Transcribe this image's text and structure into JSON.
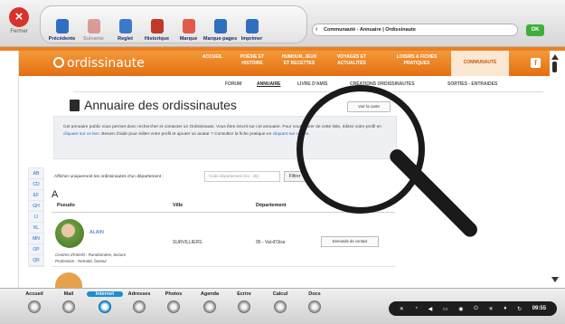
{
  "topbar": {
    "close_label": "Fermer",
    "close_glyph": "×",
    "toolbar": [
      {
        "label": "Précédente",
        "icon": "back-page-icon",
        "color": "#2f6fc2",
        "disabled": false
      },
      {
        "label": "Suivante",
        "icon": "forward-page-icon",
        "color": "#c0392b",
        "disabled": true
      },
      {
        "label": "Reglet",
        "icon": "ruler-icon",
        "color": "#3a7ac9",
        "disabled": false
      },
      {
        "label": "Historique",
        "icon": "history-icon",
        "color": "#c0392b",
        "disabled": false
      },
      {
        "label": "Marque",
        "icon": "bookmark-icon",
        "color": "#e45a4a",
        "disabled": false
      },
      {
        "label": "Marque-pages",
        "icon": "bookmarks-icon",
        "color": "#2f6fc2",
        "disabled": false
      },
      {
        "label": "Imprimer",
        "icon": "printer-icon",
        "color": "#2f6fc2",
        "disabled": false
      }
    ],
    "address": "Communauté - Annuaire | Ordissinaute",
    "ok_label": "OK"
  },
  "site": {
    "logo": "ordissinaute",
    "nav": [
      {
        "label": "ACCUEIL",
        "active": false
      },
      {
        "label": "POÉSIE ET HISTOIRE",
        "active": false
      },
      {
        "label": "HUMOUR, JEUX ET RECETTES",
        "active": false
      },
      {
        "label": "VOYAGES ET ACTUALITÉS",
        "active": false
      },
      {
        "label": "LOISIRS & FICHES PRATIQUES",
        "active": false
      },
      {
        "label": "COMMUNAUTÉ",
        "active": true
      }
    ],
    "facebook": "f",
    "subnav": [
      {
        "label": "FORUM",
        "active": false
      },
      {
        "label": "ANNUAIRE",
        "active": true
      },
      {
        "label": "LIVRE D'AMIS",
        "active": false
      },
      {
        "label": "CRÉATIONS ORDISSINAUTES",
        "active": false
      },
      {
        "label": "SORTIES - ENTRAIDES",
        "active": false
      }
    ]
  },
  "directory": {
    "title": "Annuaire des ordissinautes",
    "map_button": "Voir la carte",
    "intro": {
      "part1": "Cet annuaire public vous permet donc rechercher et contacter un Ordissinaute. Vous êtes inscrit sur cet annuaire. Pour vous retirer de cette liste, éditez votre profil en ",
      "link1": "cliquant sur ce lien",
      "part2": ". Besoin d'aide pour éditer votre profil et ajouter un avatar ? Consultez la fiche pratique en ",
      "link2": "cliquant sur ce lien",
      "part3": "."
    },
    "az_index": [
      "AB",
      "CD",
      "EF",
      "GH",
      "IJ",
      "KL",
      "MN",
      "OP",
      "QR"
    ],
    "filter_label": "Afficher uniquement les ordissinautes d'un département :",
    "filter_placeholder": "Code département (ex : 49)",
    "filter_button": "Filtrer",
    "current_letter": "A",
    "columns": [
      "Pseudo",
      "Ville",
      "Département"
    ],
    "rows": [
      {
        "pseudo": "ALAIN",
        "ville": "SURVILLIERS",
        "departement": "95 - Val-d'Oise",
        "contact_label": "Demande de contact",
        "interests_line1": "Centres d'intérêt : Randonnées, lecture",
        "interests_line2": "Profession : Retraité, facteur"
      }
    ]
  },
  "bottombar": {
    "items": [
      {
        "label": "Accueil",
        "active": false
      },
      {
        "label": "Mail",
        "active": false
      },
      {
        "label": "Internet",
        "active": true
      },
      {
        "label": "Adresses",
        "active": false
      },
      {
        "label": "Photos",
        "active": false
      },
      {
        "label": "Agenda",
        "active": false
      },
      {
        "label": "Ecrire",
        "active": false
      },
      {
        "label": "Calcul",
        "active": false
      },
      {
        "label": "Docs",
        "active": false
      }
    ],
    "tray_icons": [
      "settings-icon",
      "wifi-icon",
      "volume-icon",
      "battery-icon",
      "sync-icon",
      "power-icon",
      "brightness-icon",
      "trash-icon",
      "refresh-icon"
    ],
    "tray_glyphs": [
      "✕",
      "◔",
      "◀",
      "▭",
      "◉",
      "⏻",
      "☀",
      "♦",
      "↻"
    ],
    "clock": "09:55"
  }
}
